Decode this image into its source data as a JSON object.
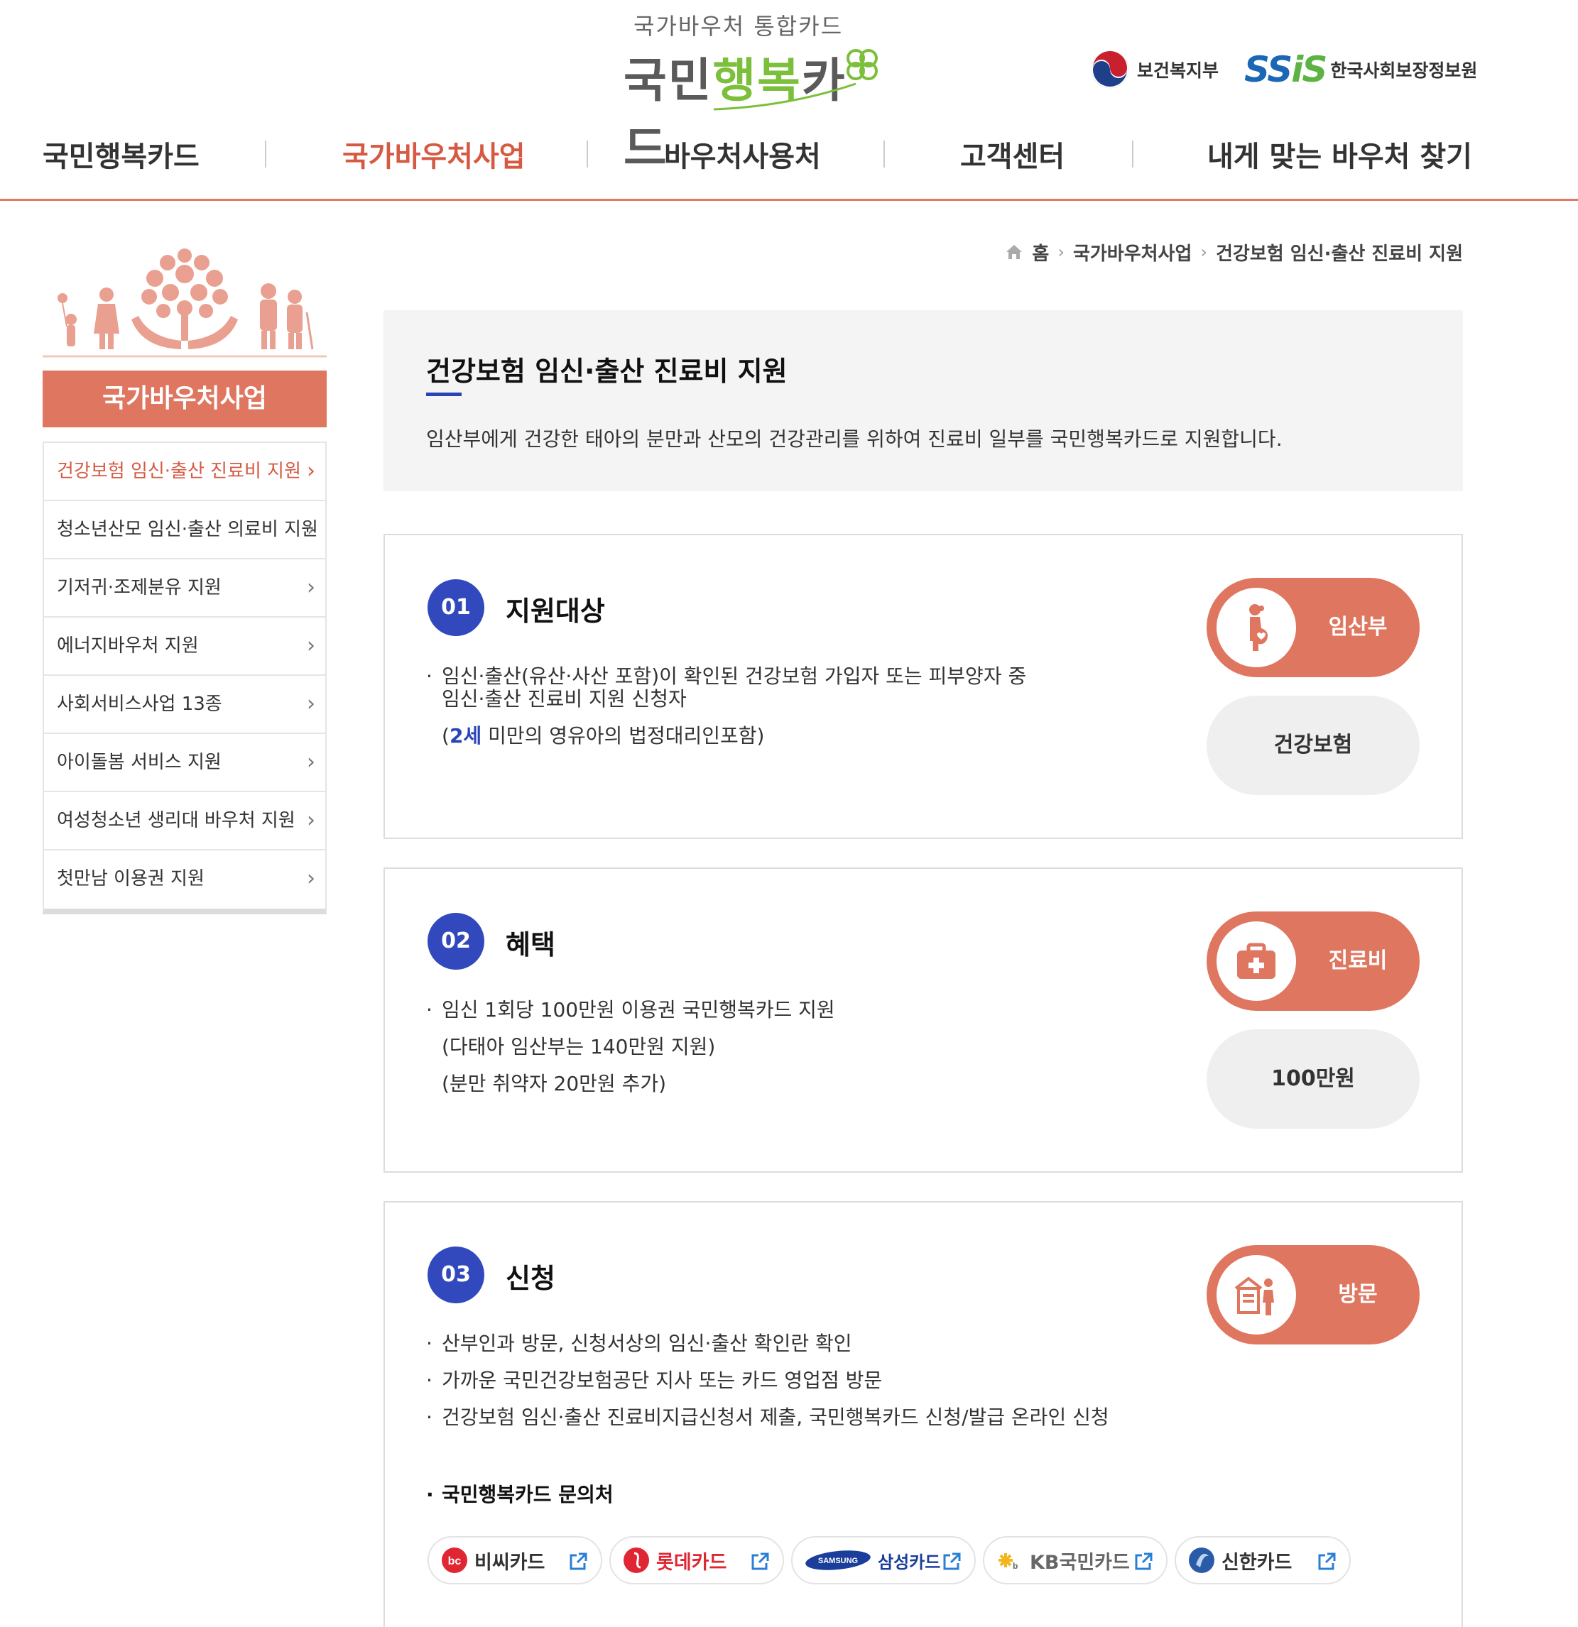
{
  "header": {
    "logo_sub": "국가바우처 통합카드",
    "logo_main_a": "국민",
    "logo_main_b": "행복",
    "logo_main_c": "카드",
    "ministry": "보건복지부",
    "ssis_mark_a": "SS",
    "ssis_mark_b": "iS",
    "ssis_name": "한국사회보장정보원"
  },
  "nav": {
    "items": [
      {
        "label": "국민행복카드"
      },
      {
        "label": "국가바우처사업"
      },
      {
        "label": "바우처사용처"
      },
      {
        "label": "고객센터"
      },
      {
        "label": "내게 맞는 바우처 찾기"
      }
    ],
    "accent_color": "#d65a43"
  },
  "sidebar": {
    "title": "국가바우처사업",
    "items": [
      {
        "label": "건강보험 임신·출산 진료비 지원"
      },
      {
        "label": "청소년산모 임신·출산 의료비 지원"
      },
      {
        "label": "기저귀·조제분유 지원"
      },
      {
        "label": "에너지바우처 지원"
      },
      {
        "label": "사회서비스사업 13종"
      },
      {
        "label": "아이돌봄 서비스 지원"
      },
      {
        "label": "여성청소년 생리대 바우처 지원"
      },
      {
        "label": "첫만남 이용권 지원"
      }
    ]
  },
  "breadcrumb": {
    "home": "홈",
    "level1": "국가바우처사업",
    "level2": "건강보험 임신·출산 진료비 지원"
  },
  "intro": {
    "title": "건강보험 임신·출산 진료비 지원",
    "description": "임산부에게 건강한 태아의 분만과 산모의 건강관리를 위하여 진료비 일부를 국민행복카드로 지원합니다."
  },
  "sections": [
    {
      "num": "01",
      "title": "지원대상",
      "line1": "임신·출산(유산·사산 포함)이 확인된 건강보험 가입자 또는 피부양자 중",
      "line2": "임신·출산 진료비 지원 신청자",
      "line3_open": "(",
      "line3_highlight": "2세",
      "line3_rest": " 미만의 영유아의 법정대리인포함)",
      "pill_coral": "임산부",
      "pill_grey": "건강보험"
    },
    {
      "num": "02",
      "title": "혜택",
      "line1": "임신 1회당 100만원 이용권 국민행복카드 지원",
      "line2": "(다태아 임산부는 140만원 지원)",
      "line3": "(분만 취약자 20만원 추가)",
      "pill_coral": "진료비",
      "pill_grey": "100만원"
    },
    {
      "num": "03",
      "title": "신청",
      "line1": "산부인과 방문, 신청서상의 임신·출산 확인란 확인",
      "line2": "가까운 국민건강보험공단 지사 또는 카드 영업점 방문",
      "line3": "건강보험 임신·출산 진료비지급신청서 제출, 국민행복카드 신청/발급 온라인 신청",
      "pill_coral": "방문",
      "contact_title": "국민행복카드 문의처",
      "cards": [
        {
          "name": "비씨카드",
          "icon": "bc-logo-icon"
        },
        {
          "name": "롯데카드",
          "icon": "lotte-logo-icon"
        },
        {
          "name": "삼성카드",
          "icon": "samsung-logo-icon",
          "mark_text": "SAMSUNG"
        },
        {
          "name": "KB국민카드",
          "icon": "kb-logo-icon"
        },
        {
          "name": "신한카드",
          "icon": "shinhan-logo-icon"
        }
      ]
    }
  ]
}
